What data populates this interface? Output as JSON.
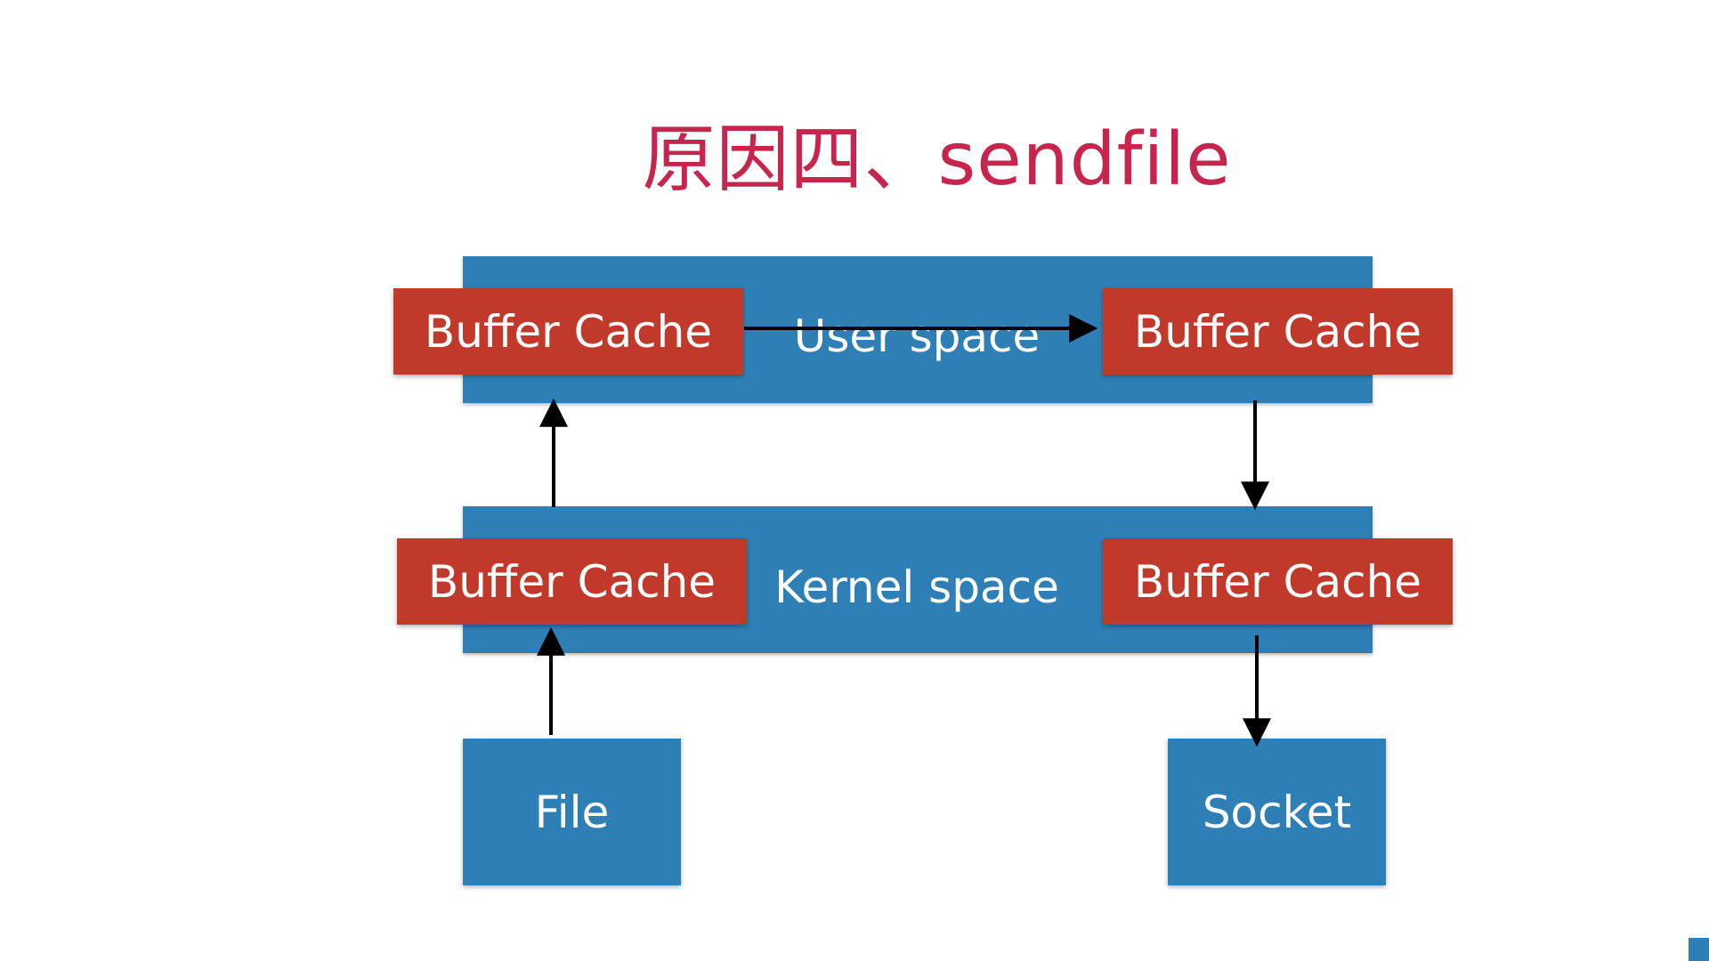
{
  "slide": {
    "title": "原因四、sendfile"
  },
  "diagram": {
    "user_space_label": "User space",
    "kernel_space_label": "Kernel space",
    "buffer_cache_label": "Buffer Cache",
    "file_label": "File",
    "socket_label": "Socket",
    "colors": {
      "title": "#c7254e",
      "blue": "#2f7fb7",
      "red": "#c0392b",
      "arrow": "#000000"
    }
  }
}
